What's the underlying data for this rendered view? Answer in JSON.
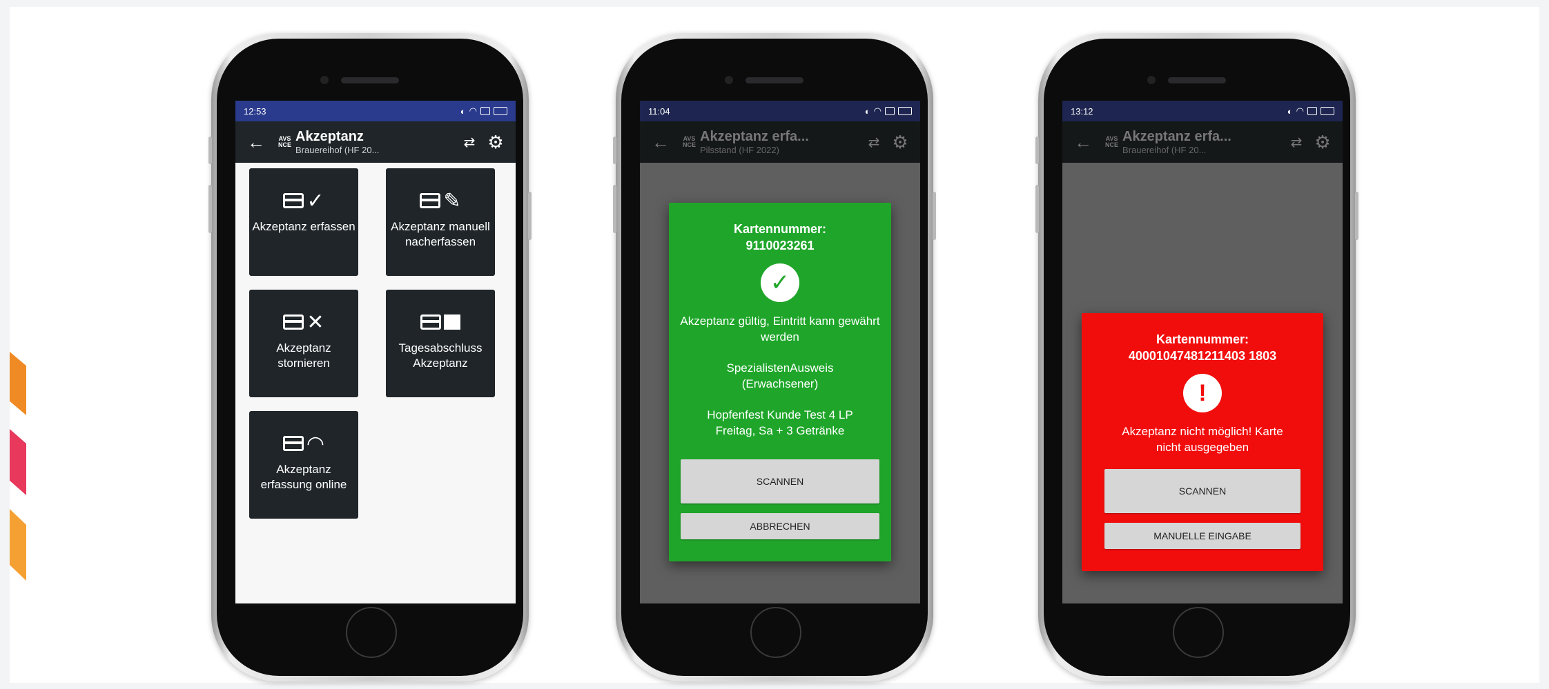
{
  "phone1": {
    "status_time": "12:53",
    "title": "Akzeptanz",
    "subtitle": "Brauereihof (HF 20...",
    "logo_line1": "AVS",
    "logo_line2": "NCE",
    "tiles": [
      {
        "icon": "card-check-icon",
        "label": "Akzeptanz erfassen"
      },
      {
        "icon": "card-edit-icon",
        "label": "Akzeptanz manuell nacherfassen"
      },
      {
        "icon": "card-cancel-icon",
        "label": "Akzeptanz stornieren"
      },
      {
        "icon": "card-report-icon",
        "label": "Tagesabschluss Akzeptanz"
      },
      {
        "icon": "card-wifi-icon",
        "label": "Akzeptanz erfassung online"
      }
    ]
  },
  "phone2": {
    "status_time": "11:04",
    "title": "Akzeptanz erfa...",
    "subtitle": "Pilsstand (HF 2022)",
    "logo_line1": "AVS",
    "logo_line2": "NCE",
    "dialog": {
      "heading": "Kartennummer:",
      "number": "9110023261",
      "message": "Akzeptanz gültig, Eintritt kann gewährt werden",
      "card_type": "SpezialistenAusweis (Erwachsener)",
      "customer": "Hopfenfest Kunde Test 4 LP Freitag, Sa + 3 Getränke",
      "primary_button": "SCANNEN",
      "secondary_button": "ABBRECHEN",
      "color": "#1fa62a"
    }
  },
  "phone3": {
    "status_time": "13:12",
    "title": "Akzeptanz erfa...",
    "subtitle": "Brauereihof (HF 20...",
    "logo_line1": "AVS",
    "logo_line2": "NCE",
    "dialog": {
      "heading": "Kartennummer:",
      "number": "40001047481211403 1803",
      "message": "Akzeptanz nicht möglich! Karte nicht ausgegeben",
      "primary_button": "SCANNEN",
      "secondary_button": "MANUELLE EINGABE",
      "color": "#f20d0d"
    }
  }
}
